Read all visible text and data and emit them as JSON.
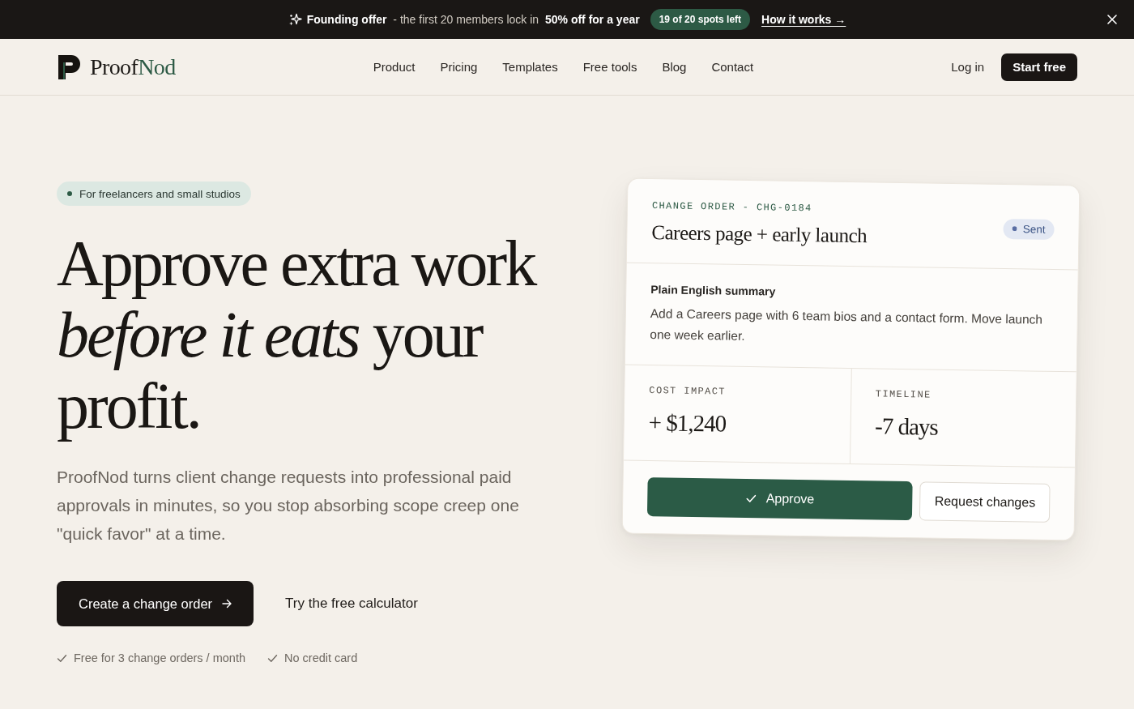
{
  "announcement_bar": {
    "offer": "**Founding offer** - the first 20 members lock in **50% off for a year**",
    "badge": "19 of 20 spots left",
    "link": "How it works →"
  },
  "header": {
    "wordmark": {
      "first": "Proof",
      "second": "Nod"
    },
    "nav": [
      "Product",
      "Pricing",
      "Templates",
      "Free tools",
      "Blog",
      "Contact"
    ],
    "login": "Log in",
    "cta": "Start free"
  },
  "hero": {
    "tag": "For freelancers and small studios",
    "headline": "Approve extra work *before it eats* your profit.",
    "description": "ProofNod turns client change requests into professional paid approvals in minutes, so you stop absorbing scope creep one \"quick favor\" at a time.",
    "primary_button": "Create a change order",
    "secondary_link": "Try the free calculator",
    "perks": [
      "Free for 3 change orders / month",
      "No credit card"
    ]
  },
  "change_order_card": {
    "label": "CHANGE ORDER - CHG-0184",
    "title": "Careers page + early launch",
    "status": "Sent",
    "summary_heading": "Plain English summary",
    "summary": "Add a Careers page with 6 team bios and a contact form. Move launch one week earlier.",
    "metrics": [
      {
        "label": "COST IMPACT",
        "value": "+ $1,240"
      },
      {
        "label": "TIMELINE",
        "value": "-7 days"
      }
    ],
    "actions": [
      {
        "label": "Approve",
        "kind": "primary"
      },
      {
        "label": "Request changes",
        "kind": "secondary"
      }
    ]
  }
}
